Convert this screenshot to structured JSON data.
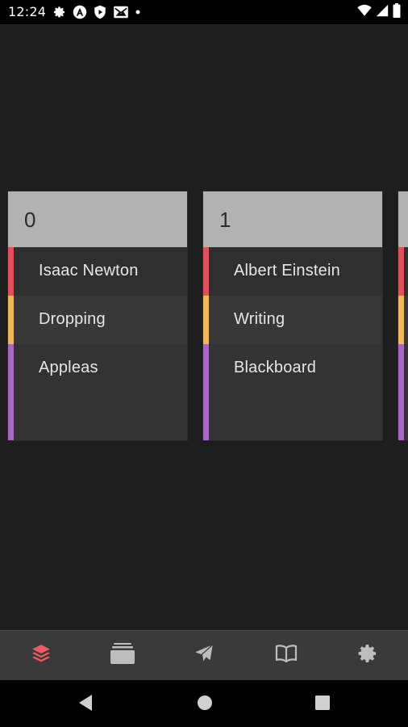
{
  "status_bar": {
    "time": "12:24",
    "icons_left": [
      "gear-icon",
      "a-circle-icon",
      "shield-play-icon",
      "mail-icon",
      "dot-icon"
    ],
    "icons_right": [
      "wifi-icon",
      "cell-signal-icon",
      "battery-icon"
    ]
  },
  "cards": [
    {
      "number": "0",
      "rows": [
        {
          "label": "Isaac Newton",
          "color": "#e0505a"
        },
        {
          "label": "Dropping",
          "color": "#f0b85a"
        },
        {
          "label": "Appleas",
          "color": "#a569c4"
        }
      ]
    },
    {
      "number": "1",
      "rows": [
        {
          "label": "Albert Einstein",
          "color": "#e0505a"
        },
        {
          "label": "Writing",
          "color": "#f0b85a"
        },
        {
          "label": "Blackboard",
          "color": "#a569c4"
        }
      ]
    },
    {
      "number": "",
      "rows": [
        {
          "label": "",
          "color": "#e0505a"
        },
        {
          "label": "",
          "color": "#f0b85a"
        },
        {
          "label": "",
          "color": "#a569c4"
        }
      ]
    }
  ],
  "bottom_nav": {
    "items": [
      {
        "icon": "layers-icon",
        "active": true,
        "color": "#f05a62"
      },
      {
        "icon": "cards-stack-icon",
        "active": false,
        "color": "#bdbdbd"
      },
      {
        "icon": "send-icon",
        "active": false,
        "color": "#bdbdbd"
      },
      {
        "icon": "book-icon",
        "active": false,
        "color": "#bdbdbd"
      },
      {
        "icon": "settings-icon",
        "active": false,
        "color": "#bdbdbd"
      }
    ]
  },
  "system_nav": [
    "back-icon",
    "home-icon",
    "recents-icon"
  ]
}
